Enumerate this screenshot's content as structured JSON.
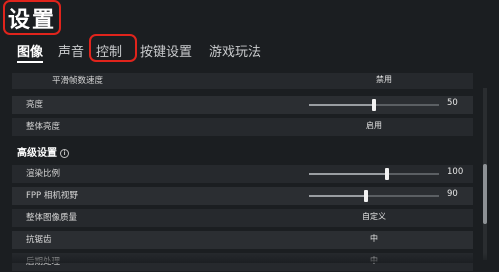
{
  "header": {
    "title": "设置"
  },
  "tabs": [
    {
      "label": "图像",
      "active": true
    },
    {
      "label": "声音",
      "active": false
    },
    {
      "label": "控制",
      "active": false
    },
    {
      "label": "按键设置",
      "active": false
    },
    {
      "label": "游戏玩法",
      "active": false
    }
  ],
  "settings": {
    "frame_smoothing": {
      "label": "平滑帧数速度",
      "value": "禁用"
    },
    "brightness": {
      "label": "亮度",
      "value": 50,
      "min": 0,
      "max": 100
    },
    "overall_brightness": {
      "label": "整体亮度",
      "value": "启用"
    },
    "advanced_section": {
      "title": "高级设置",
      "info_icon": "i"
    },
    "render_scale": {
      "label": "渲染比例",
      "value": 100,
      "min": 70,
      "max": 120
    },
    "fpp_fov": {
      "label": "FPP 相机视野",
      "value": 90,
      "min": 80,
      "max": 103
    },
    "overall_quality": {
      "label": "整体图像质量",
      "value": "自定义"
    },
    "anti_aliasing": {
      "label": "抗锯齿",
      "value": "中"
    },
    "post_processing": {
      "label": "后期处理",
      "value": "中"
    }
  },
  "colors": {
    "highlight": "#e0241c",
    "background": "#1b1e21"
  }
}
